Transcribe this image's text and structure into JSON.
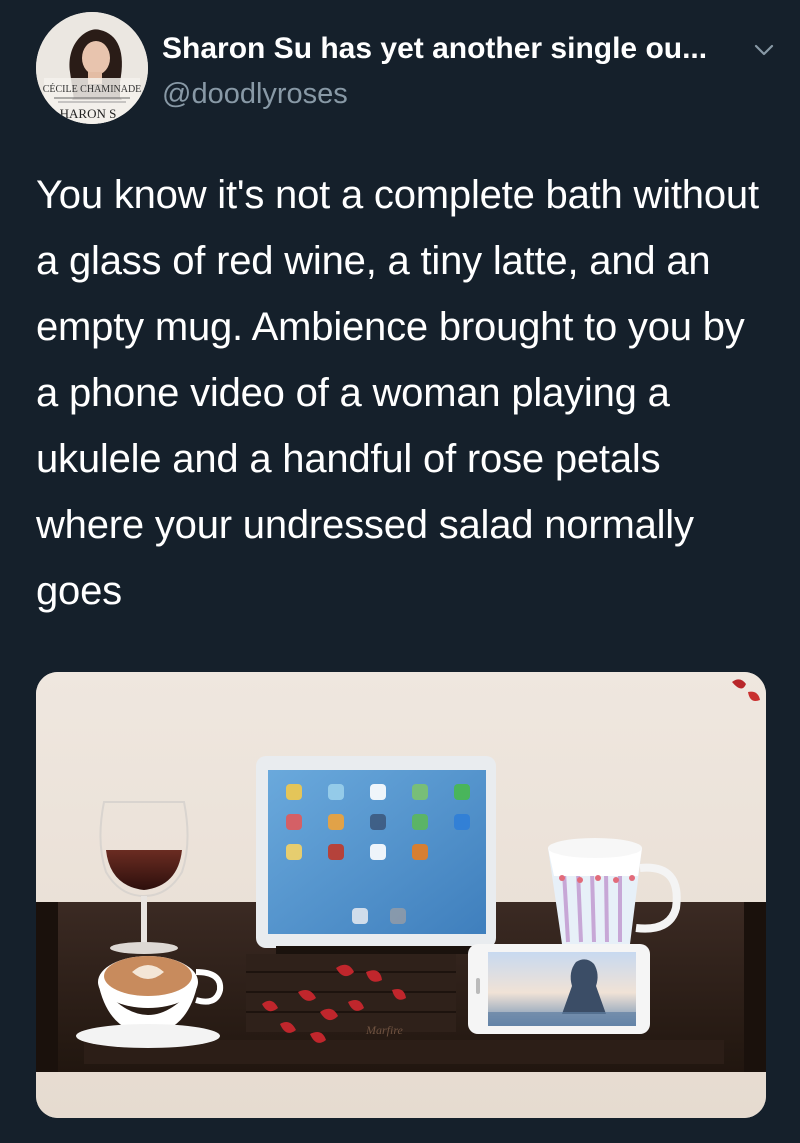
{
  "tweet": {
    "author": {
      "display_name": "Sharon Su has yet another single ou...",
      "handle": "@doodlyroses",
      "avatar_icon": "profile-avatar",
      "avatar_lettering": [
        "CÉCILE CHAMINADE",
        "HARON S"
      ]
    },
    "menu_icon": "chevron-down-icon",
    "text": "You know it's not a complete bath without a glass of red wine, a tiny latte, and an empty mug. Ambience brought to you by a phone video of a woman playing a ukulele and a handful of rose petals where your undressed salad normally goes",
    "media": {
      "type": "photo",
      "tray_wordmark": "Marfire"
    }
  },
  "colors": {
    "background": "#15202b",
    "text": "#ffffff",
    "secondary_text": "#8899a6"
  }
}
